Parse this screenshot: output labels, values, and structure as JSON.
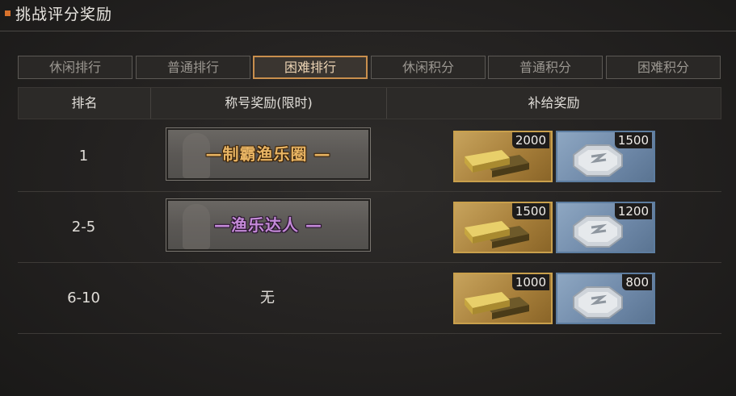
{
  "header": {
    "title": "挑战评分奖励"
  },
  "tabs": [
    {
      "label": "休闲排行",
      "active": false
    },
    {
      "label": "普通排行",
      "active": false
    },
    {
      "label": "困难排行",
      "active": true
    },
    {
      "label": "休闲积分",
      "active": false
    },
    {
      "label": "普通积分",
      "active": false
    },
    {
      "label": "困难积分",
      "active": false
    }
  ],
  "table": {
    "headers": [
      "排名",
      "称号奖励(限时)",
      "补给奖励"
    ],
    "rows": [
      {
        "rank": "1",
        "title": "—制霸渔乐圈 —",
        "title_color": "gold",
        "rewards": [
          {
            "icon": "gold-bar-icon",
            "count": "2000"
          },
          {
            "icon": "silver-coin-icon",
            "count": "1500"
          }
        ]
      },
      {
        "rank": "2-5",
        "title": "—渔乐达人 —",
        "title_color": "purple",
        "rewards": [
          {
            "icon": "gold-bar-icon",
            "count": "1500"
          },
          {
            "icon": "silver-coin-icon",
            "count": "1200"
          }
        ]
      },
      {
        "rank": "6-10",
        "title": "无",
        "title_color": "none",
        "rewards": [
          {
            "icon": "gold-bar-icon",
            "count": "1000"
          },
          {
            "icon": "silver-coin-icon",
            "count": "800"
          }
        ]
      }
    ]
  },
  "colors": {
    "accent": "#d8722c",
    "active_tab_border": "#c98f4d",
    "gold_title": "#e8b463",
    "purple_title": "#c48ad8"
  }
}
